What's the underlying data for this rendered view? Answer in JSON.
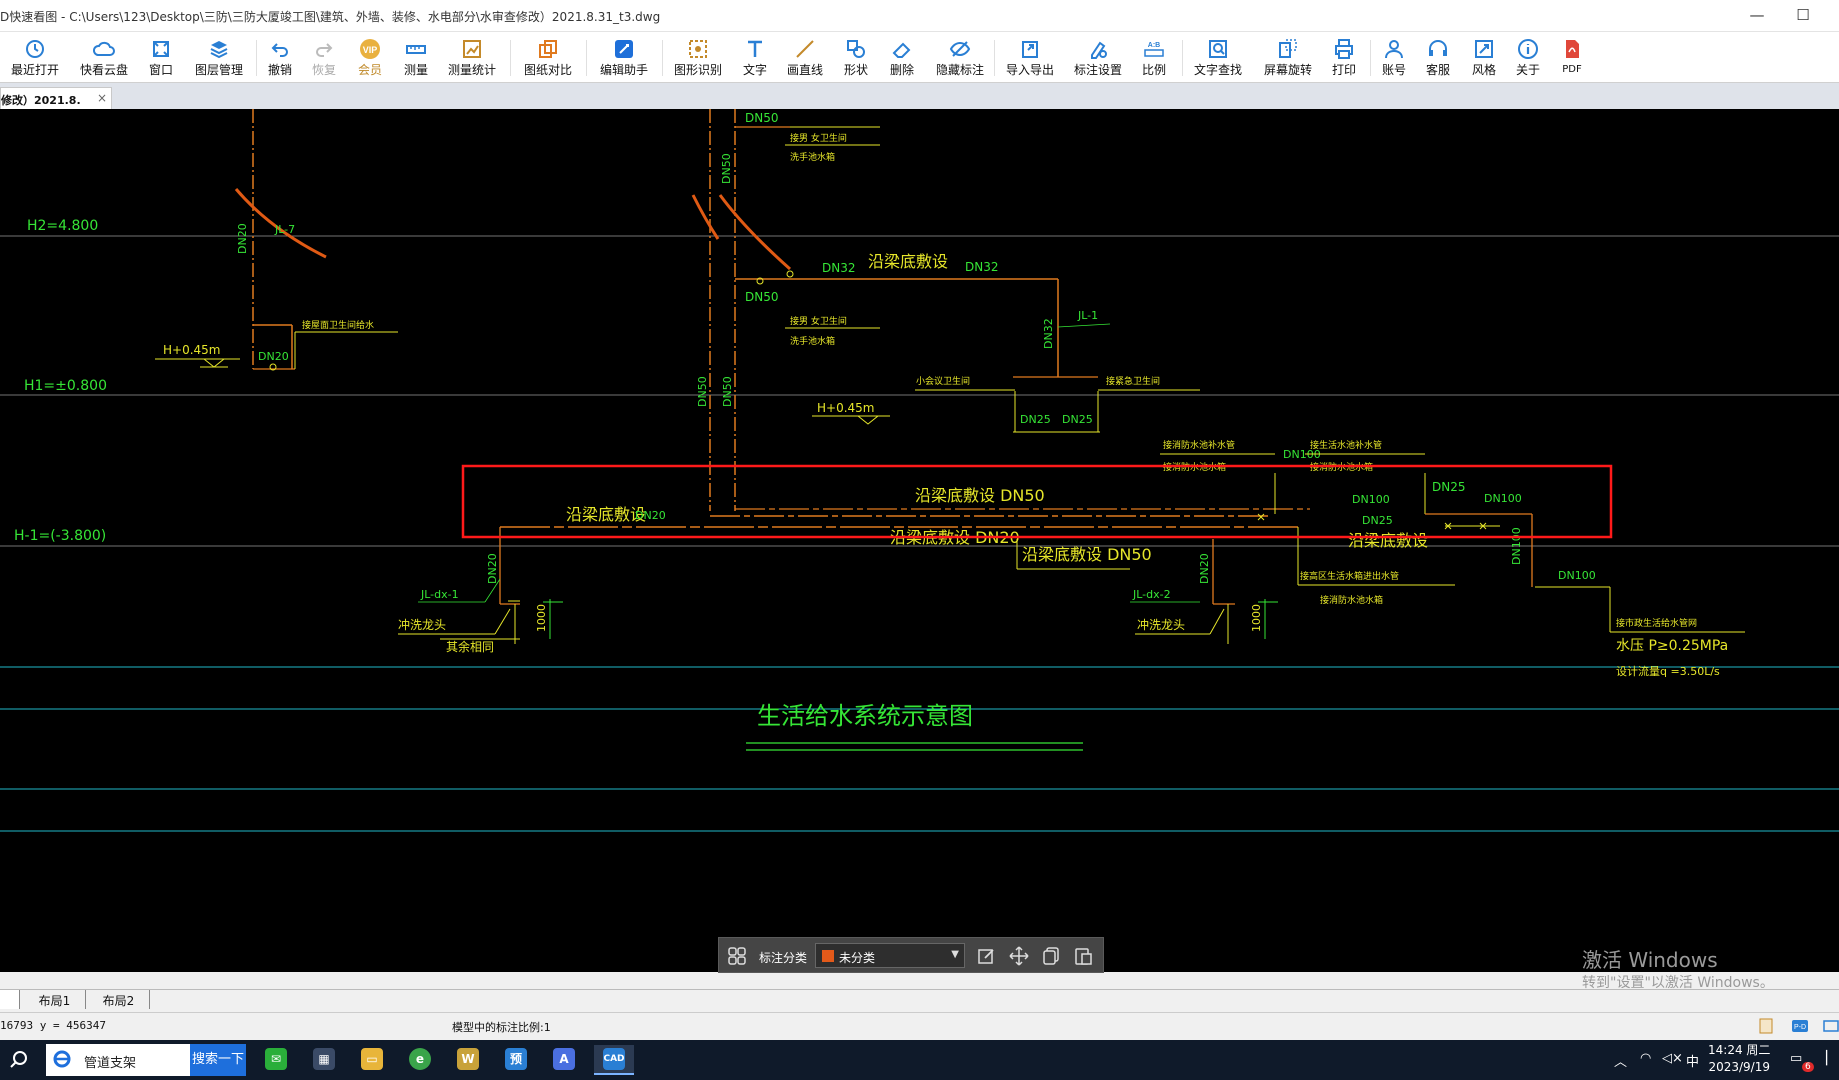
{
  "window": {
    "title": "D快速看图 - C:\\Users\\123\\Desktop\\三防\\三防大厦竣工图\\建筑、外墙、装修、水电部分\\水审查修改）2021.8.31_t3.dwg",
    "minimize": "—",
    "maximize": "☐"
  },
  "toolbar": {
    "items": [
      {
        "label": "最近打开",
        "icon": "history-icon"
      },
      {
        "label": "快看云盘",
        "icon": "cloud-icon"
      },
      {
        "label": "窗口",
        "icon": "window-icon"
      },
      {
        "label": "图层管理",
        "icon": "layers-icon"
      },
      {
        "label": "撤销",
        "icon": "undo-icon"
      },
      {
        "label": "恢复",
        "icon": "redo-icon"
      },
      {
        "label": "会员",
        "icon": "vip-icon"
      },
      {
        "label": "测量",
        "icon": "ruler-icon"
      },
      {
        "label": "测量统计",
        "icon": "measure-stats-icon"
      },
      {
        "label": "图纸对比",
        "icon": "compare-icon"
      },
      {
        "label": "编辑助手",
        "icon": "edit-assistant-icon"
      },
      {
        "label": "图形识别",
        "icon": "shape-recognition-icon"
      },
      {
        "label": "文字",
        "icon": "text-icon"
      },
      {
        "label": "画直线",
        "icon": "line-icon"
      },
      {
        "label": "形状",
        "icon": "shape-icon"
      },
      {
        "label": "删除",
        "icon": "eraser-icon"
      },
      {
        "label": "隐藏标注",
        "icon": "eye-hidden-icon"
      },
      {
        "label": "导入导出",
        "icon": "import-export-icon"
      },
      {
        "label": "标注设置",
        "icon": "annotation-settings-icon"
      },
      {
        "label": "比例",
        "icon": "scale-icon"
      },
      {
        "label": "文字查找",
        "icon": "text-search-icon"
      },
      {
        "label": "屏幕旋转",
        "icon": "rotate-screen-icon"
      },
      {
        "label": "打印",
        "icon": "print-icon"
      },
      {
        "label": "账号",
        "icon": "user-icon"
      },
      {
        "label": "客服",
        "icon": "headset-icon"
      },
      {
        "label": "风格",
        "icon": "style-icon"
      },
      {
        "label": "关于",
        "icon": "info-icon"
      },
      {
        "label": "PDF",
        "icon": "pdf-icon"
      }
    ]
  },
  "doc_tab": {
    "label": "修改）2021.8.",
    "close": "×"
  },
  "drawing": {
    "elevations": {
      "h2": "H2=4.800",
      "h1": "H1=±0.800",
      "hm1": "H-1=(-3.800)"
    },
    "texts": {
      "dn50": "DN50",
      "dn32": "DN32",
      "dn25": "DN25",
      "dn20": "DN20",
      "dn100": "DN100",
      "beam_lay": "沿梁底敷设",
      "beam_lay_dn50": "沿梁底敷设 DN50",
      "beam_lay_dn20": "沿梁底敷设 DN20",
      "jl7": "JL-7",
      "jl1": "JL-1",
      "jldx1": "JL-dx-1",
      "jldx2": "JL-dx-2",
      "h045": "H+0.45m",
      "flush_faucet": "冲洗龙头",
      "valve_well": "其余相同",
      "h1000": "1000",
      "supply_pressure": "水压 P≥0.25MPa",
      "design_flow": "设计流量q =3.50L/s",
      "title": "生活给水系统示意图",
      "small_a": "接男 女卫生间",
      "small_b": "洗手池水箱",
      "small_c": "接屋面卫生间给水",
      "small_d": "小会议卫生间",
      "small_e": "接紧急卫生间",
      "small_f": "接消防水池补水管",
      "small_g": "接生活水池补水管",
      "small_h": "接消防水池水箱",
      "small_i": "接市政生活给水管网",
      "small_j": "接高区生活水箱进出水管"
    }
  },
  "annotation_bar": {
    "label": "标注分类",
    "category": "未分类",
    "category_color": "#e35a1a"
  },
  "watermark": {
    "line1": "激活 Windows",
    "line2": "转到\"设置\"以激活 Windows。"
  },
  "layout_tabs": [
    "布局1",
    "布局2"
  ],
  "status": {
    "coords": "16793 y = 456347",
    "scale": "模型中的标注比例:1"
  },
  "taskbar": {
    "search_text": "管道支架",
    "search_button": "搜索一下",
    "apps": [
      "wechat",
      "calculator",
      "explorer",
      "360",
      "wps",
      "preview",
      "a-app",
      "cad-viewer"
    ],
    "preview_label": "预",
    "time": "14:24 周二",
    "date": "2023/9/19",
    "ime": "中",
    "notifications": "6"
  }
}
